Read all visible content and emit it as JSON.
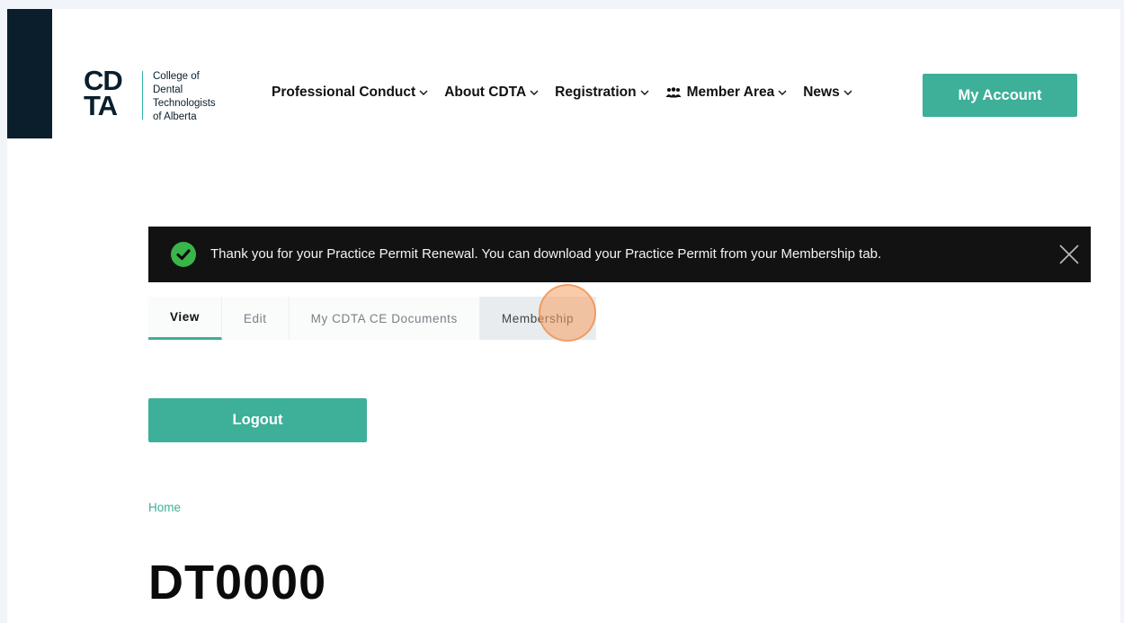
{
  "header": {
    "logo": {
      "mark_top": "CD",
      "mark_bottom": "TA",
      "lines": [
        "College of",
        "Dental",
        "Technologists",
        "of Alberta"
      ]
    },
    "nav": [
      {
        "label": "Professional Conduct",
        "icon": "chevron-down-icon"
      },
      {
        "label": "About CDTA",
        "icon": "chevron-down-icon"
      },
      {
        "label": "Registration",
        "icon": "chevron-down-icon"
      },
      {
        "label": "Member Area",
        "icon": "chevron-down-icon",
        "leading_icon": "people-icon"
      },
      {
        "label": "News",
        "icon": "chevron-down-icon"
      }
    ],
    "my_account_label": "My Account"
  },
  "notice": {
    "message": "Thank you for your Practice Permit Renewal. You can download your Practice Permit from your Membership tab.",
    "icon": "check-circle-icon",
    "close_icon": "close-icon"
  },
  "tabs": [
    {
      "label": "View",
      "state": "active"
    },
    {
      "label": "Edit",
      "state": "default"
    },
    {
      "label": "My CDTA CE Documents",
      "state": "default"
    },
    {
      "label": "Membership",
      "state": "hover"
    }
  ],
  "logout_label": "Logout",
  "breadcrumb": "Home",
  "page_title": "DT0000",
  "colors": {
    "accent": "#3eaf99",
    "dark": "#0a1e2c",
    "notice_bg": "#121212",
    "success": "#39b54a",
    "click_marker": "#f6a062"
  }
}
